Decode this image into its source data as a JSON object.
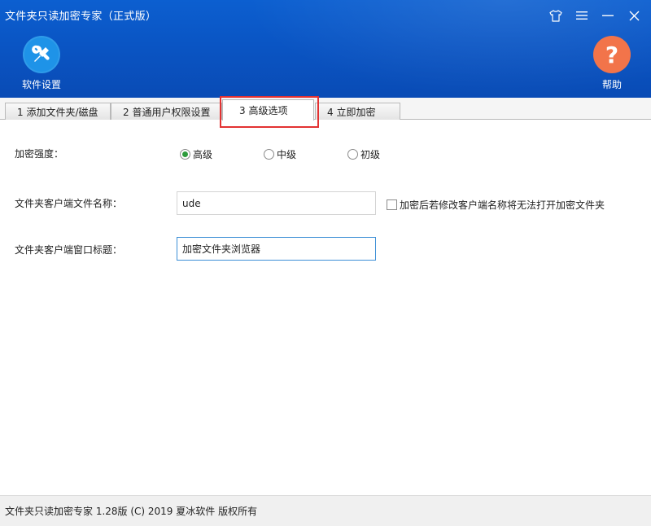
{
  "window": {
    "title": "文件夹只读加密专家（正式版）"
  },
  "toolbar": {
    "settings_label": "软件设置",
    "help_label": "帮助",
    "help_glyph": "?"
  },
  "tabs": [
    {
      "label": "1 添加文件夹/磁盘"
    },
    {
      "label": "2 普通用户权限设置"
    },
    {
      "label": "3 高级选项"
    },
    {
      "label": "4 立即加密"
    }
  ],
  "advanced": {
    "strength_label": "加密强度：",
    "strength_options": [
      {
        "label": "高级",
        "selected": true
      },
      {
        "label": "中级",
        "selected": false
      },
      {
        "label": "初级",
        "selected": false
      }
    ],
    "client_filename_label": "文件夹客户端文件名称：",
    "client_filename_value": "ude",
    "client_filename_checkbox": "加密后若修改客户端名称将无法打开加密文件夹",
    "client_title_label": "文件夹客户端窗口标题：",
    "client_title_value": "加密文件夹浏览器"
  },
  "status": {
    "text": "文件夹只读加密专家 1.28版 (C) 2019 夏冰软件 版权所有"
  },
  "colors": {
    "header_blue": "#0a55c4",
    "settings_icon_bg": "#1e93e8",
    "help_icon_bg": "#f2744a",
    "highlight_red": "#e33232",
    "radio_selected": "#2e9b3c"
  },
  "icons": {
    "skin": "shirt-icon",
    "menu": "menu-icon",
    "minimize": "minimize-icon",
    "close": "close-icon",
    "settings": "wrench-screwdriver-icon",
    "help": "question-icon"
  }
}
